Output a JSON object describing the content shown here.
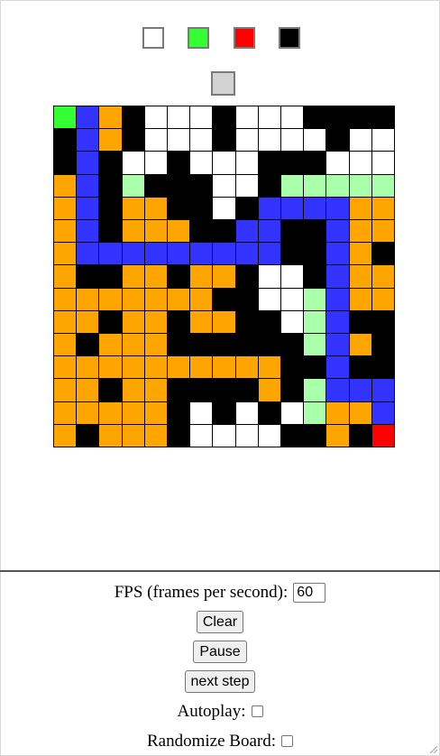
{
  "palette": {
    "swatches": [
      {
        "name": "white",
        "color": "#ffffff"
      },
      {
        "name": "green",
        "color": "#33ff33"
      },
      {
        "name": "red",
        "color": "#ff0000"
      },
      {
        "name": "black",
        "color": "#000000"
      }
    ],
    "eraser_color": "#d3d3d3"
  },
  "board": {
    "colors": {
      "W": "#ffffff",
      "K": "#000000",
      "O": "#ffa500",
      "B": "#3333ff",
      "G": "#33ff33",
      "L": "#aaffaa",
      "R": "#ff0000"
    },
    "rows": [
      "GBOKWWWKWWWKKKK",
      "KBOKWWWKWWWWKWW",
      "KBKWWKWWWKKKWWW",
      "OBKLKKKWWKLLLLL",
      "OBKOOKKWKBBBBOO",
      "OBKOOOKKBBKKBOO",
      "OBBBBBBBBBKKBOK",
      "OKKOOKOOKWWKBOO",
      "OOOOOOOKKWWLBOO",
      "OOKOOKOOKKWLBKK",
      "OKOOOKKKKKKLBOK",
      "OOOOOOOOOOKKBKK",
      "OOKOOKKKKOKLBBB",
      "OOOOOKWKWKWLOOB",
      "OKOOOKWWWWKKOKR"
    ]
  },
  "controls": {
    "fps_label": "FPS (frames per second):",
    "fps_value": "60",
    "clear_label": "Clear",
    "pause_label": "Pause",
    "next_step_label": "next step",
    "autoplay_label": "Autoplay:",
    "randomize_label": "Randomize Board:"
  }
}
